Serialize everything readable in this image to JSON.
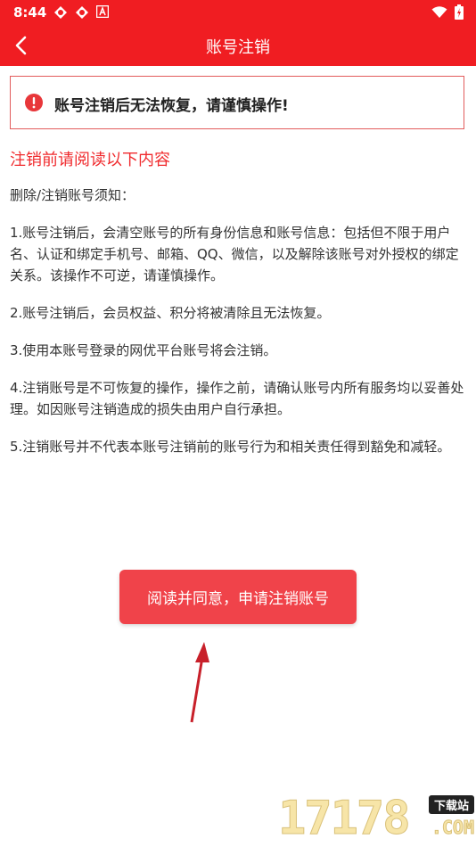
{
  "status_bar": {
    "time": "8:44",
    "left_icons": [
      "app-notification-icon",
      "app-notification-icon",
      "a-badge-icon"
    ],
    "right_icons": [
      "wifi-icon",
      "battery-icon"
    ]
  },
  "app_bar": {
    "title": "账号注销",
    "back_icon": "chevron-left-icon",
    "background": "#f01d22"
  },
  "warning": {
    "icon": "alert-icon",
    "text": "账号注销后无法恢复，请谨慎操作!"
  },
  "section_heading": "注销前请阅读以下内容",
  "notice": {
    "intro": "删除/注销账号须知：",
    "items": [
      "1.账号注销后，会清空账号的所有身份信息和账号信息：包括但不限于用户名、认证和绑定手机号、邮箱、QQ、微信，以及解除该账号对外授权的绑定关系。该操作不可逆，请谨慎操作。",
      "2.账号注销后，会员权益、积分将被清除且无法恢复。",
      "3.使用本账号登录的网优平台账号将会注销。",
      "4.注销账号是不可恢复的操作，操作之前，请确认账号内所有服务均以妥善处理。如因账号注销造成的损失由用户自行承担。",
      "5.注销账号并不代表本账号注销前的账号行为和相关责任得到豁免和减轻。"
    ]
  },
  "primary_button": {
    "label": "阅读并同意，申请注销账号",
    "color": "#f0434a"
  },
  "watermark": {
    "digits": "17178",
    "badge": "下载站",
    "suffix": ".COM"
  }
}
